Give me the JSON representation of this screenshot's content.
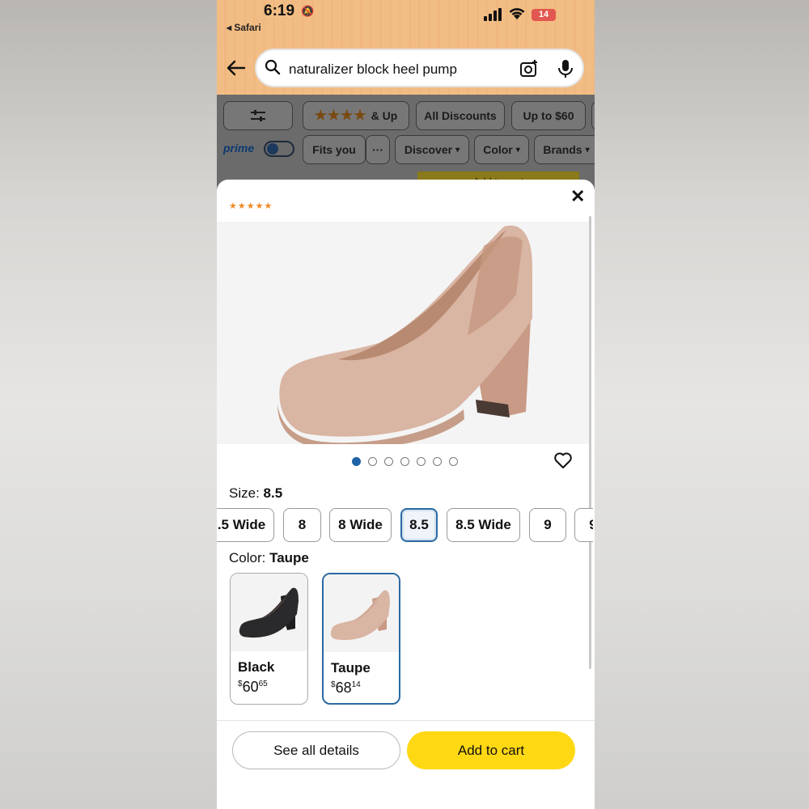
{
  "status_bar": {
    "time": "6:19",
    "back_app": "◂ Safari",
    "battery": "14"
  },
  "search": {
    "query": "naturalizer block heel pump"
  },
  "filters": {
    "chips_row1": [
      "& Up",
      "All Discounts",
      "Up to $60"
    ],
    "chips_row2": [
      "Fits you",
      "···",
      "Discover",
      "Color",
      "Brands"
    ],
    "prime_label": "prime",
    "add_to_cart_hint": "Add to cart"
  },
  "sheet": {
    "close": "✕",
    "rating_peek": "★★★★★",
    "image_dots": {
      "count": 7,
      "active_index": 0
    },
    "size_label": "Size: ",
    "size_value": "8.5",
    "sizes": [
      ".5 Wide",
      "8",
      "8 Wide",
      "8.5",
      "8.5 Wide",
      "9",
      "9"
    ],
    "selected_size_index": 3,
    "color_label": "Color: ",
    "color_value": "Taupe",
    "colors": [
      {
        "name": "Black",
        "currency": "$",
        "price_whole": "60",
        "price_fraction": "65"
      },
      {
        "name": "Taupe",
        "currency": "$",
        "price_whole": "68",
        "price_fraction": "14"
      }
    ],
    "selected_color_index": 1,
    "see_all_details": "See all details",
    "add_to_cart": "Add to cart"
  },
  "colors": {
    "header": "#f2bd84",
    "accent_blue": "#2b6aa3",
    "cart_yellow": "#ffd814",
    "shoe_taupe": "#d7b3a2",
    "shoe_black": "#2a2a2c"
  }
}
